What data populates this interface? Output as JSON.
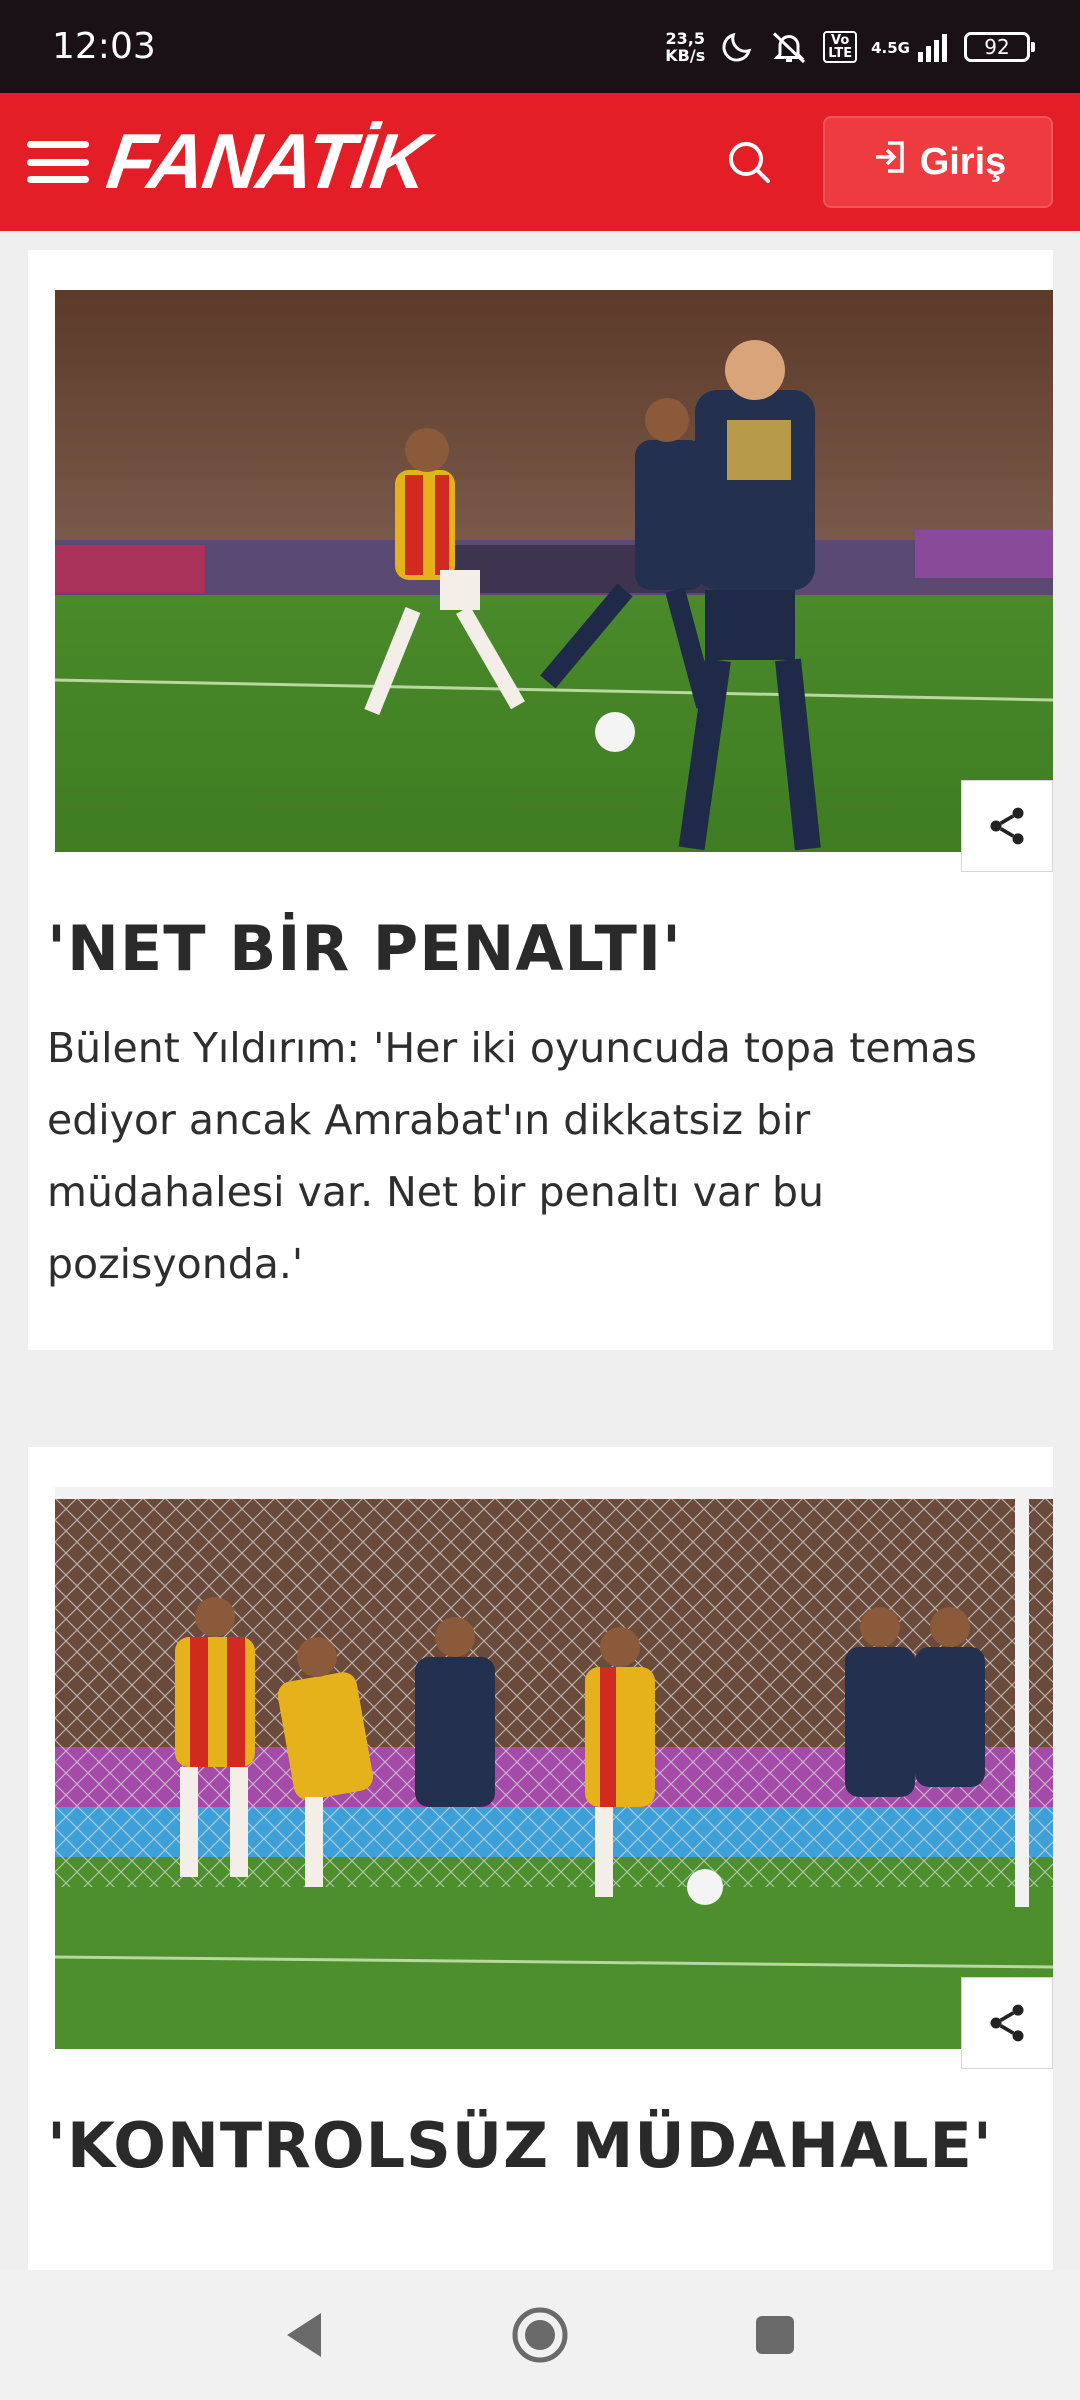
{
  "status_bar": {
    "time": "12:03",
    "net_speed_value": "23,5",
    "net_speed_unit": "KB/s",
    "volte_line1": "Vo",
    "volte_line2": "LTE",
    "network_type": "4.5G",
    "battery": "92"
  },
  "header": {
    "logo_text": "FANATİK",
    "login_label": "Giriş",
    "brand_color": "#e41e26"
  },
  "articles": [
    {
      "title": "'NET BİR PENALTI'",
      "text": "Bülent Yıldırım: 'Her iki oyuncuda topa temas ediyor ancak Amrabat'ın dikkatsiz bir müdahalesi var. Net bir penaltı var bu pozisyonda.'",
      "image_icon": "football-match-photo"
    },
    {
      "title": "'KONTROLSÜZ MÜDAHALE'",
      "image_icon": "football-goal-photo"
    }
  ],
  "nav": {
    "back_icon": "back-triangle-icon",
    "home_icon": "home-circle-icon",
    "recents_icon": "recents-square-icon"
  }
}
